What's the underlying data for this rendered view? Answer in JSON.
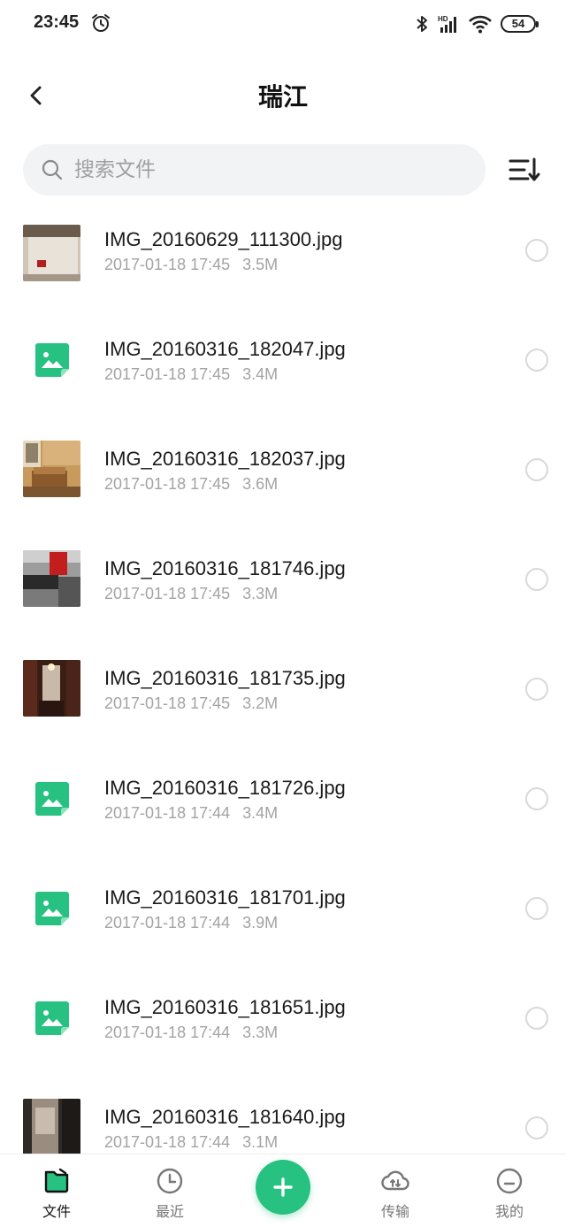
{
  "status_bar": {
    "time": "23:45",
    "battery": "54",
    "icons": [
      "alarm-icon",
      "bluetooth-icon",
      "hd-signal-icon",
      "wifi-icon",
      "battery-icon"
    ]
  },
  "header": {
    "title": "瑞江",
    "back_icon": "chevron-left-icon"
  },
  "search": {
    "placeholder": "搜索文件",
    "icon": "search-icon"
  },
  "sort_icon": "sort-icon",
  "files": [
    {
      "name": "IMG_20160629_111300.jpg",
      "date": "2017-01-18 17:45",
      "size": "3.5M",
      "thumb": "photo-bed-icon"
    },
    {
      "name": "IMG_20160316_182047.jpg",
      "date": "2017-01-18 17:45",
      "size": "3.4M",
      "thumb": "image-file-icon"
    },
    {
      "name": "IMG_20160316_182037.jpg",
      "date": "2017-01-18 17:45",
      "size": "3.6M",
      "thumb": "photo-room-icon"
    },
    {
      "name": "IMG_20160316_181746.jpg",
      "date": "2017-01-18 17:45",
      "size": "3.3M",
      "thumb": "photo-kitchen-icon"
    },
    {
      "name": "IMG_20160316_181735.jpg",
      "date": "2017-01-18 17:45",
      "size": "3.2M",
      "thumb": "photo-hallway-icon"
    },
    {
      "name": "IMG_20160316_181726.jpg",
      "date": "2017-01-18 17:44",
      "size": "3.4M",
      "thumb": "image-file-icon"
    },
    {
      "name": "IMG_20160316_181701.jpg",
      "date": "2017-01-18 17:44",
      "size": "3.9M",
      "thumb": "image-file-icon"
    },
    {
      "name": "IMG_20160316_181651.jpg",
      "date": "2017-01-18 17:44",
      "size": "3.3M",
      "thumb": "image-file-icon"
    },
    {
      "name": "IMG_20160316_181640.jpg",
      "date": "2017-01-18 17:44",
      "size": "3.1M",
      "thumb": "photo-bathroom-icon"
    }
  ],
  "bottom_nav": {
    "files": "文件",
    "recent": "最近",
    "transfer": "传输",
    "mine": "我的",
    "active": "files"
  },
  "colors": {
    "accent": "#27c181",
    "text_primary": "#1a1a1a",
    "text_secondary": "#a3a3a3",
    "search_bg": "#f2f3f5"
  }
}
